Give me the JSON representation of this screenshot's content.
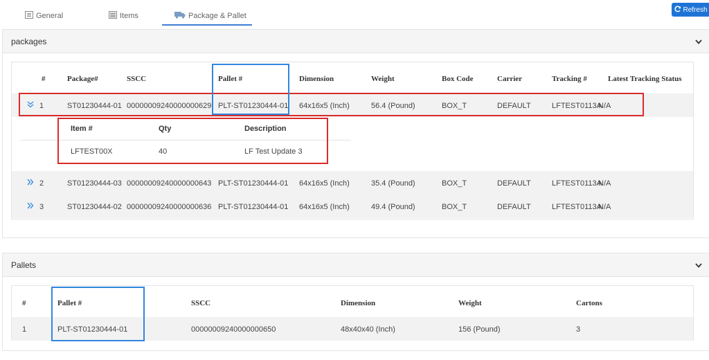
{
  "tabs": [
    {
      "label": "General",
      "icon": "form-icon"
    },
    {
      "label": "Items",
      "icon": "list-icon"
    },
    {
      "label": "Package & Pallet",
      "icon": "truck-icon"
    }
  ],
  "refresh_label": "Refresh",
  "packages": {
    "title": "packages",
    "columns": [
      "#",
      "Package#",
      "SSCC",
      "Pallet #",
      "Dimension",
      "Weight",
      "Box Code",
      "Carrier",
      "Tracking #",
      "Latest Tracking Status"
    ],
    "rows": [
      {
        "num": "1",
        "package": "ST01230444-01",
        "sscc": "00000009240000000629",
        "pallet": "PLT-ST01230444-01",
        "dimension": "64x16x5 (Inch)",
        "weight": "56.4 (Pound)",
        "box_code": "BOX_T",
        "carrier": "DEFAULT",
        "tracking": "LFTEST0113A",
        "status": "N/A",
        "expanded": true
      },
      {
        "num": "2",
        "package": "ST01230444-03",
        "sscc": "00000009240000000643",
        "pallet": "PLT-ST01230444-01",
        "dimension": "64x16x5 (Inch)",
        "weight": "35.4 (Pound)",
        "box_code": "BOX_T",
        "carrier": "DEFAULT",
        "tracking": "LFTEST0113A",
        "status": "N/A",
        "expanded": false
      },
      {
        "num": "3",
        "package": "ST01230444-02",
        "sscc": "00000009240000000636",
        "pallet": "PLT-ST01230444-01",
        "dimension": "64x16x5 (Inch)",
        "weight": "49.4 (Pound)",
        "box_code": "BOX_T",
        "carrier": "DEFAULT",
        "tracking": "LFTEST0113A",
        "status": "N/A",
        "expanded": false
      }
    ],
    "detail": {
      "columns": [
        "Item #",
        "Qty",
        "Description"
      ],
      "rows": [
        {
          "item": "LFTEST00X",
          "qty": "40",
          "description": "LF Test Update 3"
        }
      ]
    }
  },
  "pallets": {
    "title": "Pallets",
    "columns": [
      "#",
      "Pallet #",
      "SSCC",
      "Dimension",
      "Weight",
      "Cartons"
    ],
    "rows": [
      {
        "num": "1",
        "pallet": "PLT-ST01230444-01",
        "sscc": "00000009240000000650",
        "dimension": "48x40x40 (Inch)",
        "weight": "156 (Pound)",
        "cartons": "3"
      }
    ]
  },
  "colors": {
    "accent": "#1e74d6",
    "highlight_red": "#d92b2b",
    "highlight_blue": "#2f86e0"
  }
}
